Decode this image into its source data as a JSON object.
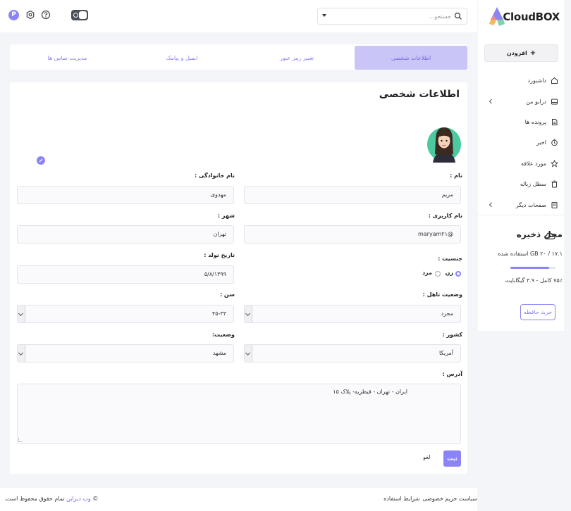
{
  "brand": {
    "name": "CloudBOX"
  },
  "search": {
    "placeholder": "جستجو..."
  },
  "sidebar": {
    "add_label": "افزودن",
    "items": [
      {
        "label": "داشبورد",
        "icon": "home-icon"
      },
      {
        "label": "درایو من",
        "icon": "drive-icon"
      },
      {
        "label": "پرونده ها",
        "icon": "file-icon"
      },
      {
        "label": "اخیر",
        "icon": "clock-icon"
      },
      {
        "label": "مورد علاقه",
        "icon": "star-icon"
      },
      {
        "label": "سطل زباله",
        "icon": "trash-icon"
      },
      {
        "label": "صفحات دیگر",
        "icon": "pages-icon"
      }
    ]
  },
  "storage": {
    "title": "محل ذخیره",
    "used_text": "۱۷.۱ / ۲۰ GB استفاده شده",
    "used_fraction": 0.855,
    "free_text": "۷۵٪ کامل - ۳.۹ گیگابایت",
    "buy_label": "خرید حافظه"
  },
  "tabs": [
    {
      "label": "اطلاعات شخصی",
      "active": true
    },
    {
      "label": "تغییر رمز عبور",
      "active": false
    },
    {
      "label": "ایمیل و پیامک",
      "active": false
    },
    {
      "label": "مدیریت تماس ها",
      "active": false
    }
  ],
  "form": {
    "title": "اطلاعات شخصی",
    "first_name_label": "نام :",
    "first_name": "مریم",
    "last_name_label": "نام خانوادگی :",
    "last_name": "مهدوی",
    "username_label": "نام کاربری :",
    "username": "@maryam۲۱",
    "city_label": "شهر :",
    "city": "تهران",
    "gender_label": "جنسیت :",
    "gender_female": "زن",
    "gender_male": "مرد",
    "birth_label": "تاریخ تولد :",
    "birth": "۵/۸/۱۳۹۹",
    "marital_label": "وضعیت تاهل :",
    "marital": "مجرد",
    "age_label": "سن :",
    "age": "۴۵-۳۳",
    "country_label": "کشور :",
    "country": "آمریکا",
    "status_label": "وضعیت:",
    "status": "مشهد",
    "address_label": "آدرس :",
    "address": "ایران - تهران - قیطریه- پلاک ۱۵",
    "submit_label": "ثبت",
    "cancel_label": "لغو"
  },
  "footer": {
    "privacy": "سیاست حریم خصوصی",
    "terms": "شرایط استفاده",
    "copyright_brand": "وب دیزاین",
    "copyright_rest": "تمام حقوق محفوظ است.",
    "copyright_symbol": "©"
  },
  "colors": {
    "accent": "#8b84f6",
    "tab_active_bg": "#c9c5f7"
  }
}
